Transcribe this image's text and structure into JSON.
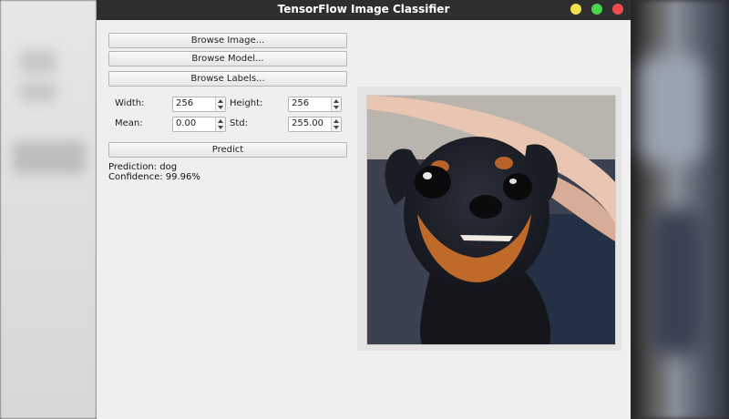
{
  "window": {
    "title": "TensorFlow Image Classifier"
  },
  "buttons": {
    "browse_image": "Browse Image...",
    "browse_model": "Browse Model...",
    "browse_labels": "Browse Labels...",
    "predict": "Predict"
  },
  "params": {
    "width_label": "Width:",
    "width_value": "256",
    "height_label": "Height:",
    "height_value": "256",
    "mean_label": "Mean:",
    "mean_value": "0.00",
    "std_label": "Std:",
    "std_value": "255.00"
  },
  "result": {
    "prediction": "Prediction: dog",
    "confidence": "Confidence: 99.96%"
  },
  "image": {
    "subject": "dog-photo"
  },
  "colors": {
    "titlebar": "#2e2e2e",
    "window_bg": "#efefef",
    "minimize": "#f4e04d",
    "maximize": "#4cd44c",
    "close": "#f24b4b"
  }
}
